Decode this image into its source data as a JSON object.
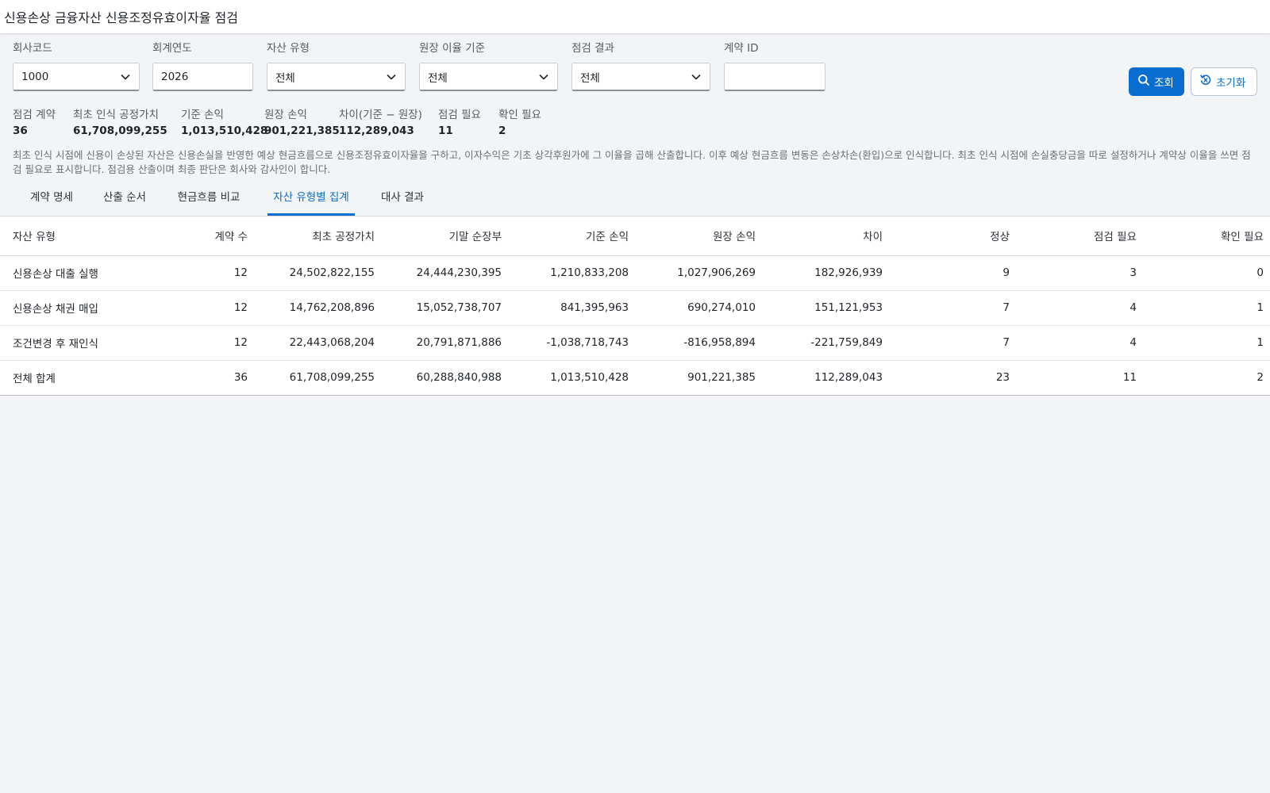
{
  "page": {
    "title": "신용손상 금융자산 신용조정유효이자율 점검"
  },
  "filters": {
    "company_code": {
      "label": "회사코드",
      "value": "1000"
    },
    "fiscal_year": {
      "label": "회계연도",
      "value": "2026"
    },
    "asset_type": {
      "label": "자산 유형",
      "value": "전체"
    },
    "ledger_rate_basis": {
      "label": "원장 이율 기준",
      "value": "전체"
    },
    "check_result": {
      "label": "점검 결과",
      "value": "전체"
    },
    "contract_id": {
      "label": "계약 ID",
      "value": "",
      "placeholder": ""
    }
  },
  "actions": {
    "search_label": "조회",
    "reset_label": "초기화"
  },
  "kpis": [
    {
      "label": "점검 계약",
      "value": "36"
    },
    {
      "label": "최초 인식 공정가치",
      "value": "61,708,099,255"
    },
    {
      "label": "기준 손익",
      "value": "1,013,510,428"
    },
    {
      "label": "원장 손익",
      "value": "901,221,385"
    },
    {
      "label": "차이(기준 − 원장)",
      "value": "112,289,043"
    },
    {
      "label": "점검 필요",
      "value": "11"
    },
    {
      "label": "확인 필요",
      "value": "2"
    }
  ],
  "note": "최초 인식 시점에 신용이 손상된 자산은 신용손실을 반영한 예상 현금흐름으로 신용조정유효이자율을 구하고, 이자수익은 기초 상각후원가에 그 이율을 곱해 산출합니다. 이후 예상 현금흐름 변동은 손상차손(환입)으로 인식합니다. 최초 인식 시점에 손실충당금을 따로 설정하거나 계약상 이율을 쓰면 점검 필요로 표시합니다. 점검용 산출이며 최종 판단은 회사와 감사인이 합니다.",
  "tabs": [
    {
      "label": "계약 명세",
      "active": false
    },
    {
      "label": "산출 순서",
      "active": false
    },
    {
      "label": "현금흐름 비교",
      "active": false
    },
    {
      "label": "자산 유형별 집계",
      "active": true
    },
    {
      "label": "대사 결과",
      "active": false
    }
  ],
  "table": {
    "headers": [
      "자산 유형",
      "계약 수",
      "최초 공정가치",
      "기말 순장부",
      "기준 손익",
      "원장 손익",
      "차이",
      "정상",
      "점검 필요",
      "확인 필요"
    ],
    "rows": [
      [
        "신용손상 대출 실행",
        "12",
        "24,502,822,155",
        "24,444,230,395",
        "1,210,833,208",
        "1,027,906,269",
        "182,926,939",
        "9",
        "3",
        "0"
      ],
      [
        "신용손상 채권 매입",
        "12",
        "14,762,208,896",
        "15,052,738,707",
        "841,395,963",
        "690,274,010",
        "151,121,953",
        "7",
        "4",
        "1"
      ],
      [
        "조건변경 후 재인식",
        "12",
        "22,443,068,204",
        "20,791,871,886",
        "-1,038,718,743",
        "-816,958,894",
        "-221,759,849",
        "7",
        "4",
        "1"
      ],
      [
        "전체 합계",
        "36",
        "61,708,099,255",
        "60,288,840,988",
        "1,013,510,428",
        "901,221,385",
        "112,289,043",
        "23",
        "11",
        "2"
      ]
    ]
  }
}
